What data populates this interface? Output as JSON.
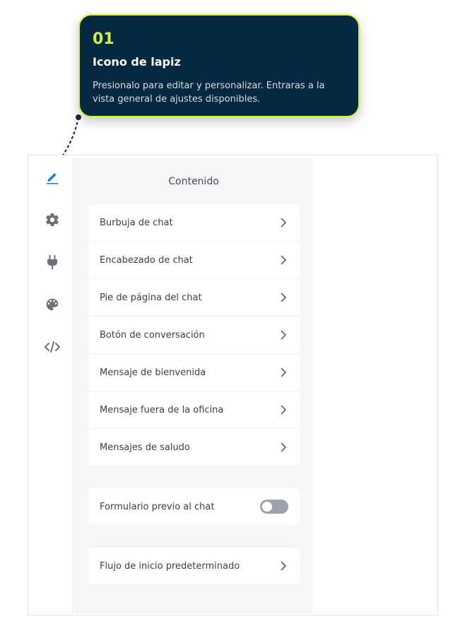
{
  "callout": {
    "number": "01",
    "title": "Icono de lapiz",
    "description": "Presionalo para editar y personalizar. Entraras a la vista general de ajustes disponibles."
  },
  "rail": {
    "items": [
      {
        "icon": "pencil-icon",
        "active": true
      },
      {
        "icon": "gear-icon",
        "active": false
      },
      {
        "icon": "plug-icon",
        "active": false
      },
      {
        "icon": "palette-icon",
        "active": false
      },
      {
        "icon": "code-icon",
        "active": false
      }
    ]
  },
  "panel": {
    "title": "Contenido",
    "content_items": [
      {
        "label": "Burbuja de chat"
      },
      {
        "label": "Encabezado de chat"
      },
      {
        "label": "Pie de página del chat"
      },
      {
        "label": "Botón de conversación"
      },
      {
        "label": "Mensaje de bienvenida"
      },
      {
        "label": "Mensaje fuera de la oficina"
      },
      {
        "label": "Mensajes de saludo"
      }
    ],
    "prechat_form": {
      "label": "Formulario previo al chat",
      "enabled": false
    },
    "default_flow": {
      "label": "Flujo de inicio predeterminado"
    }
  },
  "colors": {
    "callout_bg": "#062840",
    "callout_accent": "#d6f13a",
    "active_icon": "#1a7fd4",
    "icon": "#6b7079",
    "toggle_off": "#9ca3ad"
  }
}
